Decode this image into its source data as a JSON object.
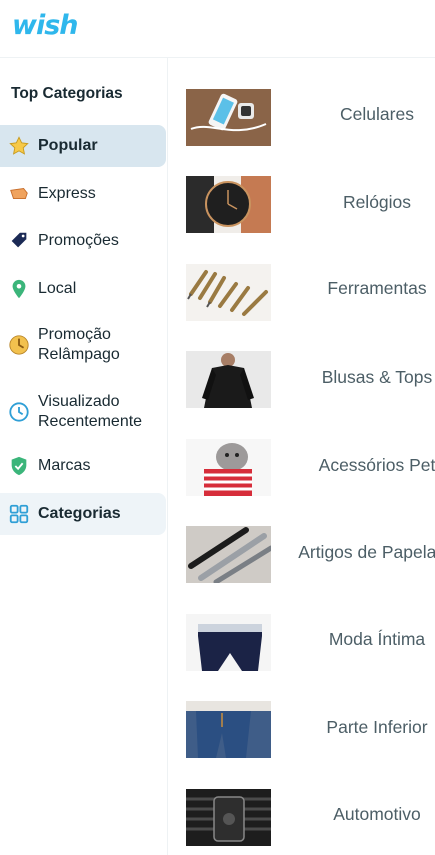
{
  "app": {
    "logo_text": "wish",
    "brand_color": "#2fb7ec"
  },
  "sidebar": {
    "title": "Top Categorias",
    "items": [
      {
        "label": "Popular",
        "icon": "star-icon",
        "state": "active"
      },
      {
        "label": "Express",
        "icon": "express-delivery-icon"
      },
      {
        "label": "Promoções",
        "icon": "tag-icon"
      },
      {
        "label": "Local",
        "icon": "location-pin-icon"
      },
      {
        "label": "Promoção Relâmpago",
        "icon": "flash-deal-icon"
      },
      {
        "label": "Visualizado Recentemente",
        "icon": "clock-icon"
      },
      {
        "label": "Marcas",
        "icon": "verified-shield-icon"
      },
      {
        "label": "Categorias",
        "icon": "grid-icon",
        "state": "selected"
      }
    ]
  },
  "categories": [
    {
      "label": "Celulares",
      "image": "phone-image"
    },
    {
      "label": "Relógios",
      "image": "watch-image"
    },
    {
      "label": "Ferramentas",
      "image": "tools-image"
    },
    {
      "label": "Blusas & Tops",
      "image": "shirt-image"
    },
    {
      "label": "Acessórios Pet",
      "image": "pet-image"
    },
    {
      "label": "Artigos de Papelaria",
      "image": "pens-image"
    },
    {
      "label": "Moda Íntima",
      "image": "underwear-image"
    },
    {
      "label": "Parte Inferior",
      "image": "jeans-image"
    },
    {
      "label": "Automotivo",
      "image": "car-mount-image"
    }
  ]
}
